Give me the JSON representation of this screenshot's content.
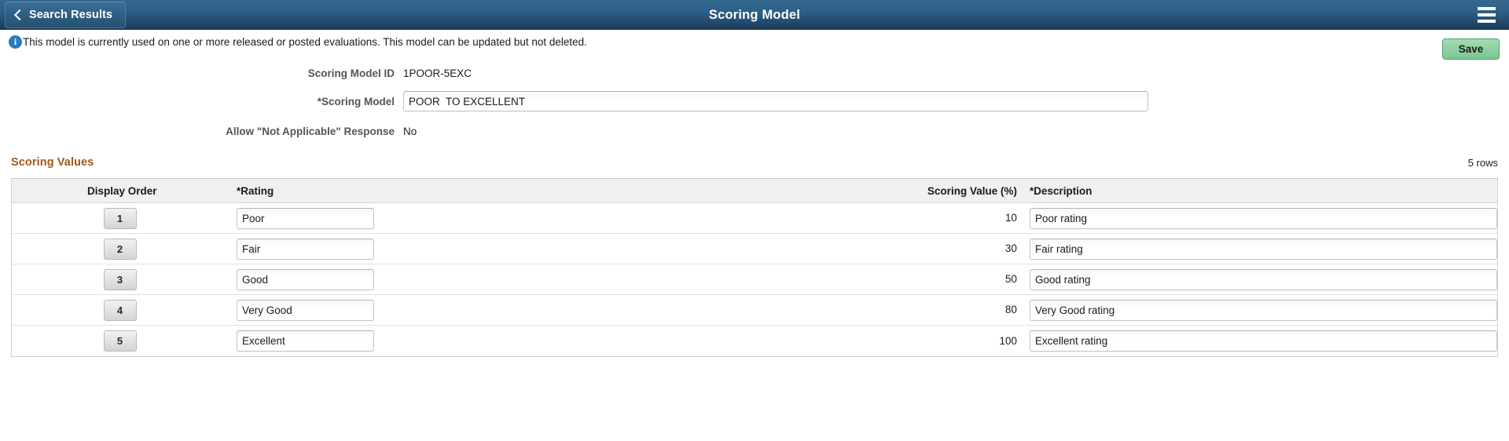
{
  "header": {
    "back_label": "Search Results",
    "title": "Scoring Model",
    "menu_icon": "hamburger-menu-icon"
  },
  "notification": {
    "icon": "info-icon",
    "icon_glyph": "i",
    "message": "This model is currently used on one or more released or posted evaluations. This model can be updated but not deleted."
  },
  "toolbar": {
    "save_label": "Save"
  },
  "form": {
    "scoring_model_id_label": "Scoring Model ID",
    "scoring_model_id_value": "1POOR-5EXC",
    "scoring_model_label": "*Scoring Model",
    "scoring_model_value": "POOR  TO EXCELLENT",
    "allow_na_label": "Allow \"Not Applicable\" Response",
    "allow_na_value": "No"
  },
  "scoring_values": {
    "section_title": "Scoring Values",
    "row_count": "5 rows",
    "columns": {
      "display_order": "Display Order",
      "rating": "*Rating",
      "scoring_value": "Scoring Value (%)",
      "description": "*Description"
    },
    "rows": [
      {
        "order": "1",
        "rating": "Poor",
        "score": "10",
        "description": "Poor rating"
      },
      {
        "order": "2",
        "rating": "Fair",
        "score": "30",
        "description": "Fair rating"
      },
      {
        "order": "3",
        "rating": "Good",
        "score": "50",
        "description": "Good rating"
      },
      {
        "order": "4",
        "rating": "Very Good",
        "score": "80",
        "description": "Very Good rating"
      },
      {
        "order": "5",
        "rating": "Excellent",
        "score": "100",
        "description": "Excellent rating"
      }
    ]
  },
  "colors": {
    "header_top": "#35688f",
    "header_bottom": "#1b3a55",
    "section_title": "#a1581d",
    "save_green": "#8ed0a1",
    "info_blue": "#2c7bbd"
  }
}
